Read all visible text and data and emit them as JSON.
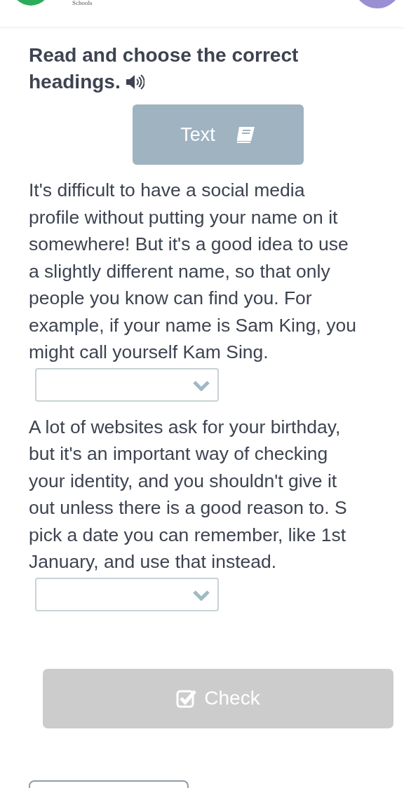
{
  "header": {
    "logo_caption": "Schools"
  },
  "task": {
    "title": "Read and choose the correct headings.",
    "audio": true
  },
  "text_button": {
    "label": "Text"
  },
  "sections": [
    {
      "lines": [
        "It's difficult to have a social media",
        "profile without putting your name on it",
        "somewhere! But it's a good idea to use",
        "a slightly different name, so that only",
        "people you know can find you. For",
        "example, if your name is Sam King, you",
        "might call yourself Kam Sing."
      ],
      "answer": {
        "kind": "dropdown"
      }
    },
    {
      "lines": [
        "A lot of websites ask for your birthday,",
        "but it's an important way of checking",
        "your identity, and you shouldn't give it",
        "out unless there is a good reason to. S",
        "pick a date you can remember, like 1st",
        "January, and use that instead."
      ],
      "answer": {
        "kind": "dropdown"
      }
    }
  ],
  "check_button": {
    "label": "Check",
    "disabled": true
  }
}
